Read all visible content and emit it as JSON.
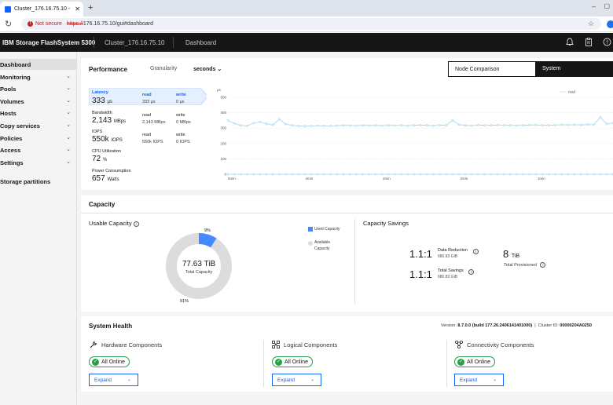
{
  "browser": {
    "tab_title": "Cluster_176.16.75.10 - Dashboa",
    "tab_close": "✕",
    "new_tab": "+",
    "not_secure": "Not secure",
    "url_scheme": "https://",
    "url_rest": "176.16.75.10/gui#dashboard",
    "minimize": "–"
  },
  "header": {
    "brand": "IBM Storage FlashSystem 5300",
    "cluster": "Cluster_176.16.75.10",
    "page": "Dashboard"
  },
  "sidebar": {
    "items": [
      {
        "label": "Dashboard"
      },
      {
        "label": "Monitoring"
      },
      {
        "label": "Pools"
      },
      {
        "label": "Volumes"
      },
      {
        "label": "Hosts"
      },
      {
        "label": "Copy services"
      },
      {
        "label": "Policies"
      },
      {
        "label": "Access"
      },
      {
        "label": "Settings"
      },
      {
        "label": "Storage partitions"
      }
    ]
  },
  "performance": {
    "title": "Performance",
    "granularity_label": "Granularity",
    "granularity_value": "seconds",
    "node_comparison": "Node Comparison",
    "system": "System",
    "latency": {
      "label": "Latency",
      "value": "333",
      "unit": "µs",
      "read_label": "read",
      "read_value": "333 µs",
      "write_label": "write",
      "write_value": "0 µs"
    },
    "bandwidth": {
      "label": "Bandwidth",
      "value": "2,143",
      "unit": "MBps",
      "read_label": "read",
      "read_value": "2,143 MBps",
      "write_label": "write",
      "write_value": "0 MBps"
    },
    "iops": {
      "label": "IOPS",
      "value": "550k",
      "unit": "IOPS",
      "read_label": "read",
      "read_value": "550k IOPS",
      "write_label": "write",
      "write_value": "0 IOPS"
    },
    "cpu": {
      "label": "CPU Utilization",
      "value": "72",
      "unit": "%"
    },
    "power": {
      "label": "Power Consumption",
      "value": "657",
      "unit": "Watts"
    }
  },
  "chart_data": {
    "type": "line",
    "ylabel": "µs",
    "ylim": [
      0,
      500
    ],
    "y_ticks": [
      "0",
      "100",
      "200",
      "300",
      "400",
      "500"
    ],
    "x_ticks": [
      "5min",
      "4min",
      "3min",
      "2min",
      "1min"
    ],
    "legend": [
      "read"
    ],
    "series": [
      {
        "name": "read",
        "color": "#9ed4e6",
        "values": [
          350,
          330,
          318,
          314,
          332,
          340,
          328,
          320,
          358,
          326,
          318,
          314,
          312,
          314,
          316,
          315,
          314,
          316,
          318,
          317,
          316,
          318,
          317,
          318,
          316,
          318,
          317,
          318,
          316,
          318,
          320,
          318,
          316,
          319,
          318,
          350,
          322,
          318,
          316,
          320,
          318,
          318,
          320,
          319,
          318,
          317,
          318,
          320,
          321,
          318,
          319,
          320,
          322,
          321,
          322,
          320,
          323,
          322,
          370,
          328,
          332
        ]
      },
      {
        "name": "write",
        "color": "#9ed4e6",
        "values": [
          0,
          0,
          0,
          0,
          0,
          0,
          0,
          0,
          0,
          0,
          0,
          0,
          0,
          0,
          0,
          0,
          0,
          0,
          0,
          0,
          0,
          0,
          0,
          0,
          0,
          0,
          0,
          0,
          0,
          0,
          0,
          0,
          0,
          0,
          0,
          0,
          0,
          0,
          0,
          0,
          0,
          0,
          0,
          0,
          0,
          0,
          0,
          0,
          0,
          0,
          0,
          0,
          0,
          0,
          0,
          0,
          0,
          0,
          0,
          0,
          0
        ]
      }
    ]
  },
  "capacity": {
    "title": "Capacity",
    "usable_title": "Usable Capacity",
    "used_pct": 9,
    "used_pct_text": "9%",
    "available_pct_text": "91%",
    "total_value": "77.63 TiB",
    "total_label": "Total Capacity",
    "legend_used": "Used Capacity",
    "legend_available": "Available Capacity",
    "savings_title": "Capacity Savings",
    "data_reduction_ratio": "1.1:1",
    "data_reduction_label": "Data Reduction",
    "data_reduction_value": "680.83 GiB",
    "total_savings_ratio": "1.1:1",
    "total_savings_label": "Total Savings",
    "total_savings_value": "680.83 GiB",
    "provisioned_value": "8",
    "provisioned_unit": "TiB",
    "provisioned_label": "Total Provisioned",
    "colors": {
      "used": "#4589ff",
      "available": "#dcdcdc"
    }
  },
  "health": {
    "title": "System Health",
    "version_label": "Version:",
    "version_value": "8.7.0.0 (build 177.26.2406141401000)",
    "cluster_id_label": "Cluster ID:",
    "cluster_id_value": "00000204A0250",
    "hardware": {
      "title": "Hardware Components",
      "status": "All Online",
      "expand": "Expand"
    },
    "logical": {
      "title": "Logical Components",
      "status": "All Online",
      "expand": "Expand"
    },
    "connectivity": {
      "title": "Connectivity Components",
      "status": "All Online",
      "expand": "Expand"
    }
  }
}
